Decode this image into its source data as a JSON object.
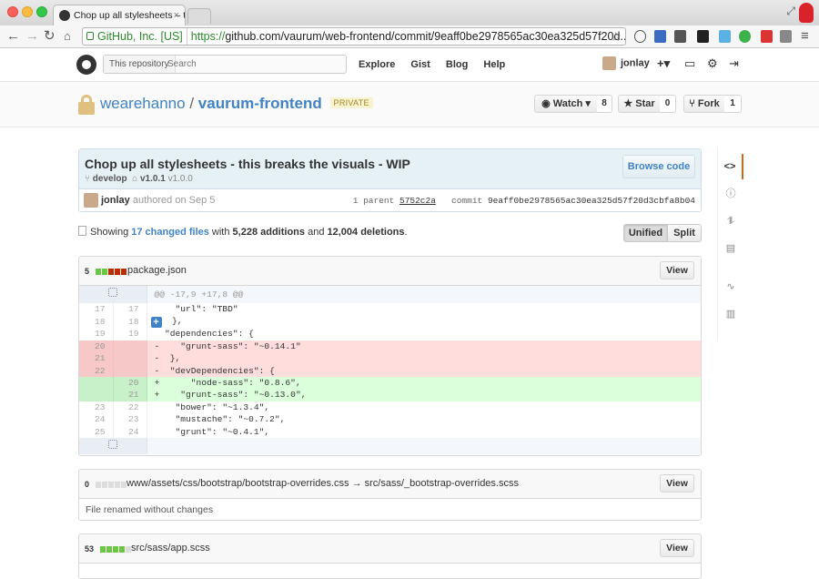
{
  "browser": {
    "tab_title": "Chop up all stylesheets – t",
    "tab_close": "×",
    "ev_cert": "GitHub, Inc. [US]",
    "url_scheme": "https://",
    "url_rest": "github.com/vaurum/web-frontend/commit/9eaff0be2978565ac30ea325d57f20d..."
  },
  "header": {
    "search_scope": "This repository",
    "search_placeholder": "Search",
    "nav": [
      "Explore",
      "Gist",
      "Blog",
      "Help"
    ],
    "username": "jonlay",
    "new_icon": "+▾"
  },
  "repo": {
    "owner": "wearehanno",
    "separator": "/",
    "name": "vaurum-frontend",
    "badge": "PRIVATE",
    "watch_label": "Watch ▾",
    "watch_count": "8",
    "star_label": "Star",
    "star_count": "0",
    "fork_label": "Fork",
    "fork_count": "1"
  },
  "commit": {
    "title": "Chop up all stylesheets - this breaks the visuals - WIP",
    "branch": "develop",
    "tags": "v1.0.1",
    "tag_extra": "v1.0.0",
    "browse_label": "Browse code",
    "author": "jonlay",
    "authored_text": "authored on Sep 5",
    "parent_label": "1 parent",
    "parent_sha": "5752c2a",
    "commit_label": "commit",
    "commit_sha": "9eaff0be2978565ac30ea325d57f20d3cbfa8b04"
  },
  "toc": {
    "showing": "Showing",
    "changed_files": "17 changed files",
    "with": "with",
    "additions": "5,228 additions",
    "and": "and",
    "deletions": "12,004 deletions",
    "period": ".",
    "unified": "Unified",
    "split": "Split"
  },
  "files": [
    {
      "stat": "5",
      "name": "package.json",
      "view": "View",
      "hunk_header": "@@ -17,9 +17,8 @@",
      "lines": [
        {
          "type": "ctx",
          "old": "17",
          "new": "17",
          "text": "    \"url\": \"TBD\""
        },
        {
          "type": "ctx",
          "old": "18",
          "new": "18",
          "text": "  },"
        },
        {
          "type": "ctx",
          "old": "19",
          "new": "19",
          "text": "  \"dependencies\": {"
        },
        {
          "type": "del",
          "old": "20",
          "new": "",
          "text": "-    \"grunt-sass\": \"~0.14.1\""
        },
        {
          "type": "del",
          "old": "21",
          "new": "",
          "text": "-  },"
        },
        {
          "type": "del",
          "old": "22",
          "new": "",
          "text": "-  \"devDependencies\": {"
        },
        {
          "type": "add",
          "old": "",
          "new": "20",
          "text": "+      \"node-sass\": \"0.8.6\","
        },
        {
          "type": "add",
          "old": "",
          "new": "21",
          "text": "+    \"grunt-sass\": \"~0.13.0\","
        },
        {
          "type": "ctx",
          "old": "23",
          "new": "22",
          "text": "    \"bower\": \"~1.3.4\","
        },
        {
          "type": "ctx",
          "old": "24",
          "new": "23",
          "text": "    \"mustache\": \"~0.7.2\","
        },
        {
          "type": "ctx",
          "old": "25",
          "new": "24",
          "text": "    \"grunt\": \"~0.4.1\","
        }
      ]
    },
    {
      "stat": "0",
      "name": "www/assets/css/bootstrap/bootstrap-overrides.css → src/sass/_bootstrap-overrides.scss",
      "view": "View",
      "body": "File renamed without changes"
    },
    {
      "stat": "53",
      "name": "src/sass/app.scss",
      "view": "View"
    }
  ],
  "colors": {
    "link": "#4183c4",
    "added": "#6cc644",
    "deleted": "#bd2c00",
    "neutral": "#cccccc"
  }
}
